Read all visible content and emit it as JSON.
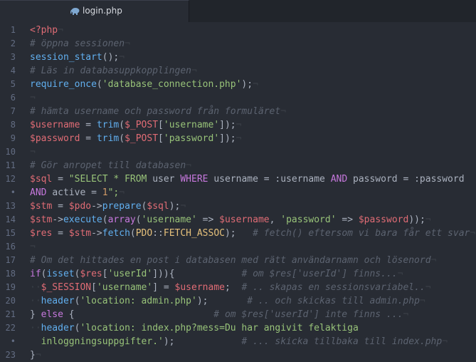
{
  "tab": {
    "filename": "login.php",
    "icon": "php-elephant-icon"
  },
  "lines": [
    {
      "n": "1",
      "tokens": [
        {
          "t": "<?php",
          "c": "var"
        },
        {
          "t": "¬",
          "c": "inv"
        }
      ]
    },
    {
      "n": "2",
      "tokens": [
        {
          "t": "# öppna sessionen",
          "c": "cm"
        },
        {
          "t": "¬",
          "c": "inv"
        }
      ]
    },
    {
      "n": "3",
      "tokens": [
        {
          "t": "session_start",
          "c": "fn"
        },
        {
          "t": "();",
          "c": ""
        },
        {
          "t": "¬",
          "c": "inv"
        }
      ]
    },
    {
      "n": "4",
      "tokens": [
        {
          "t": "# Läs in databasuppkopplingen",
          "c": "cm"
        },
        {
          "t": "¬",
          "c": "inv"
        }
      ]
    },
    {
      "n": "5",
      "tokens": [
        {
          "t": "require_once",
          "c": "fn"
        },
        {
          "t": "(",
          "c": ""
        },
        {
          "t": "'database_connection.php'",
          "c": "str"
        },
        {
          "t": ");",
          "c": ""
        },
        {
          "t": "¬",
          "c": "inv"
        }
      ]
    },
    {
      "n": "6",
      "tokens": [
        {
          "t": "¬",
          "c": "inv"
        }
      ]
    },
    {
      "n": "7",
      "tokens": [
        {
          "t": "# hämta username och password från formuläret",
          "c": "cm"
        },
        {
          "t": "¬",
          "c": "inv"
        }
      ]
    },
    {
      "n": "8",
      "tokens": [
        {
          "t": "$username",
          "c": "var"
        },
        {
          "t": " = ",
          "c": ""
        },
        {
          "t": "trim",
          "c": "fn"
        },
        {
          "t": "(",
          "c": ""
        },
        {
          "t": "$_POST",
          "c": "var"
        },
        {
          "t": "[",
          "c": ""
        },
        {
          "t": "'username'",
          "c": "str"
        },
        {
          "t": "]);",
          "c": ""
        },
        {
          "t": "¬",
          "c": "inv"
        }
      ]
    },
    {
      "n": "9",
      "tokens": [
        {
          "t": "$password",
          "c": "var"
        },
        {
          "t": " = ",
          "c": ""
        },
        {
          "t": "trim",
          "c": "fn"
        },
        {
          "t": "(",
          "c": ""
        },
        {
          "t": "$_POST",
          "c": "var"
        },
        {
          "t": "[",
          "c": ""
        },
        {
          "t": "'password'",
          "c": "str"
        },
        {
          "t": "]);",
          "c": ""
        },
        {
          "t": "¬",
          "c": "inv"
        }
      ]
    },
    {
      "n": "10",
      "tokens": [
        {
          "t": "¬",
          "c": "inv"
        }
      ]
    },
    {
      "n": "11",
      "tokens": [
        {
          "t": "# Gör anropet till databasen",
          "c": "cm"
        },
        {
          "t": "¬",
          "c": "inv"
        }
      ]
    },
    {
      "n": "12",
      "tokens": [
        {
          "t": "$sql",
          "c": "var"
        },
        {
          "t": " = ",
          "c": ""
        },
        {
          "t": "\"SELECT * FROM ",
          "c": "str"
        },
        {
          "t": "user ",
          "c": ""
        },
        {
          "t": "WHERE ",
          "c": "kw"
        },
        {
          "t": "username = :username ",
          "c": ""
        },
        {
          "t": "AND ",
          "c": "kw"
        },
        {
          "t": "password = :password",
          "c": ""
        }
      ]
    },
    {
      "n": "•",
      "tokens": [
        {
          "t": "AND ",
          "c": "kw"
        },
        {
          "t": "active = ",
          "c": ""
        },
        {
          "t": "1",
          "c": "num"
        },
        {
          "t": "\";",
          "c": "str"
        },
        {
          "t": "¬",
          "c": "inv"
        }
      ]
    },
    {
      "n": "13",
      "tokens": [
        {
          "t": "$stm",
          "c": "var"
        },
        {
          "t": " = ",
          "c": ""
        },
        {
          "t": "$pdo",
          "c": "var"
        },
        {
          "t": "->",
          "c": ""
        },
        {
          "t": "prepare",
          "c": "fn"
        },
        {
          "t": "(",
          "c": ""
        },
        {
          "t": "$sql",
          "c": "var"
        },
        {
          "t": ");",
          "c": ""
        },
        {
          "t": "¬",
          "c": "inv"
        }
      ]
    },
    {
      "n": "14",
      "tokens": [
        {
          "t": "$stm",
          "c": "var"
        },
        {
          "t": "->",
          "c": ""
        },
        {
          "t": "execute",
          "c": "fn"
        },
        {
          "t": "(",
          "c": ""
        },
        {
          "t": "array",
          "c": "kw"
        },
        {
          "t": "(",
          "c": ""
        },
        {
          "t": "'username'",
          "c": "str"
        },
        {
          "t": " => ",
          "c": ""
        },
        {
          "t": "$username",
          "c": "var"
        },
        {
          "t": ", ",
          "c": ""
        },
        {
          "t": "'password'",
          "c": "str"
        },
        {
          "t": " => ",
          "c": ""
        },
        {
          "t": "$password",
          "c": "var"
        },
        {
          "t": "));",
          "c": ""
        },
        {
          "t": "¬",
          "c": "inv"
        }
      ]
    },
    {
      "n": "15",
      "tokens": [
        {
          "t": "$res",
          "c": "var"
        },
        {
          "t": " = ",
          "c": ""
        },
        {
          "t": "$stm",
          "c": "var"
        },
        {
          "t": "->",
          "c": ""
        },
        {
          "t": "fetch",
          "c": "fn"
        },
        {
          "t": "(",
          "c": ""
        },
        {
          "t": "PDO",
          "c": "cls"
        },
        {
          "t": "::",
          "c": ""
        },
        {
          "t": "FETCH_ASSOC",
          "c": "cls"
        },
        {
          "t": ");   ",
          "c": ""
        },
        {
          "t": "# fetch() eftersom vi bara får ett svar",
          "c": "cm"
        },
        {
          "t": "¬",
          "c": "inv"
        }
      ]
    },
    {
      "n": "16",
      "tokens": [
        {
          "t": "¬",
          "c": "inv"
        }
      ]
    },
    {
      "n": "17",
      "tokens": [
        {
          "t": "# Om det hittades en post i databasen med rätt användarnamn och lösenord",
          "c": "cm"
        },
        {
          "t": "¬",
          "c": "inv"
        }
      ]
    },
    {
      "n": "18",
      "tokens": [
        {
          "t": "if",
          "c": "kw"
        },
        {
          "t": "(",
          "c": ""
        },
        {
          "t": "isset",
          "c": "fn"
        },
        {
          "t": "(",
          "c": ""
        },
        {
          "t": "$res",
          "c": "var"
        },
        {
          "t": "[",
          "c": ""
        },
        {
          "t": "'userId'",
          "c": "str"
        },
        {
          "t": "])){            ",
          "c": ""
        },
        {
          "t": "# om $res['userId'] finns...",
          "c": "cm"
        },
        {
          "t": "¬",
          "c": "inv"
        }
      ]
    },
    {
      "n": "19",
      "tokens": [
        {
          "t": "··",
          "c": "inv"
        },
        {
          "t": "$_SESSION",
          "c": "var"
        },
        {
          "t": "[",
          "c": ""
        },
        {
          "t": "'username'",
          "c": "str"
        },
        {
          "t": "] = ",
          "c": ""
        },
        {
          "t": "$username",
          "c": "var"
        },
        {
          "t": ";  ",
          "c": ""
        },
        {
          "t": "# .. skapas en sessionsvariabel..",
          "c": "cm"
        },
        {
          "t": "¬",
          "c": "inv"
        }
      ]
    },
    {
      "n": "20",
      "tokens": [
        {
          "t": "··",
          "c": "inv"
        },
        {
          "t": "header",
          "c": "fn"
        },
        {
          "t": "(",
          "c": ""
        },
        {
          "t": "'location: admin.php'",
          "c": "str"
        },
        {
          "t": ");       ",
          "c": ""
        },
        {
          "t": "# .. och skickas till admin.php",
          "c": "cm"
        },
        {
          "t": "¬",
          "c": "inv"
        }
      ]
    },
    {
      "n": "21",
      "tokens": [
        {
          "t": "} ",
          "c": ""
        },
        {
          "t": "else",
          "c": "kw"
        },
        {
          "t": " {                         ",
          "c": ""
        },
        {
          "t": "# om $res['userId'] inte finns ...",
          "c": "cm"
        },
        {
          "t": "¬",
          "c": "inv"
        }
      ]
    },
    {
      "n": "22",
      "tokens": [
        {
          "t": "··",
          "c": "inv"
        },
        {
          "t": "header",
          "c": "fn"
        },
        {
          "t": "(",
          "c": ""
        },
        {
          "t": "'location: index.php?mess=Du har angivit felaktiga",
          "c": "str"
        }
      ]
    },
    {
      "n": "•",
      "tokens": [
        {
          "t": "  ",
          "c": ""
        },
        {
          "t": "inloggningsuppgifter.'",
          "c": "str"
        },
        {
          "t": ");            ",
          "c": ""
        },
        {
          "t": "# ... skicka tillbaka till index.php",
          "c": "cm"
        },
        {
          "t": "¬",
          "c": "inv"
        }
      ]
    },
    {
      "n": "23",
      "tokens": [
        {
          "t": "}",
          "c": ""
        },
        {
          "t": "¬",
          "c": "inv"
        }
      ]
    }
  ]
}
